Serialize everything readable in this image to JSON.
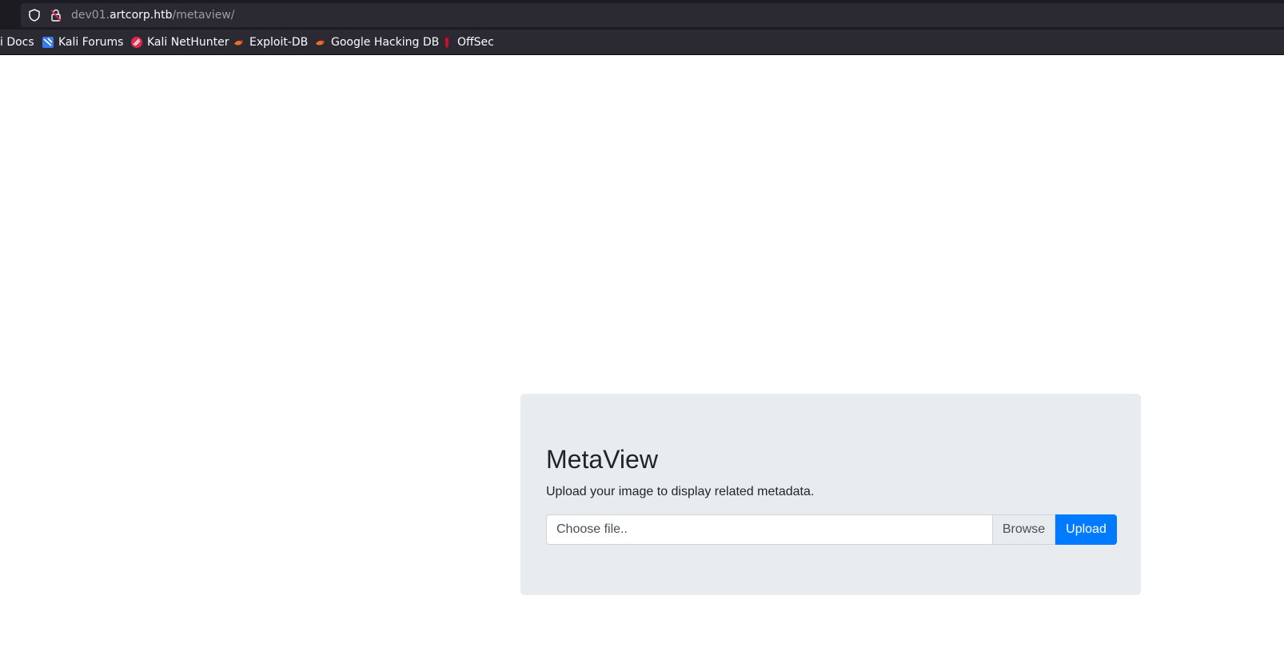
{
  "browser": {
    "url_host_prefix": "dev01.",
    "url_host_domain": "artcorp.htb",
    "url_path": "/metaview/",
    "bookmarks": [
      {
        "label": "i Docs",
        "icon": "kali-docs-icon"
      },
      {
        "label": "Kali Forums",
        "icon": "kali-forums-icon"
      },
      {
        "label": "Kali NetHunter",
        "icon": "kali-nethunter-icon"
      },
      {
        "label": "Exploit-DB",
        "icon": "exploit-db-icon"
      },
      {
        "label": "Google Hacking DB",
        "icon": "google-hacking-db-icon"
      },
      {
        "label": "OffSec",
        "icon": "offsec-icon"
      }
    ]
  },
  "main": {
    "title": "MetaView",
    "subtitle": "Upload your image to display related metadata.",
    "file_placeholder": "Choose file..",
    "browse_label": "Browse",
    "upload_label": "Upload"
  },
  "colors": {
    "accent": "#007bff",
    "panel_bg": "#e9ecef",
    "chrome_bg": "#2b2a33"
  }
}
